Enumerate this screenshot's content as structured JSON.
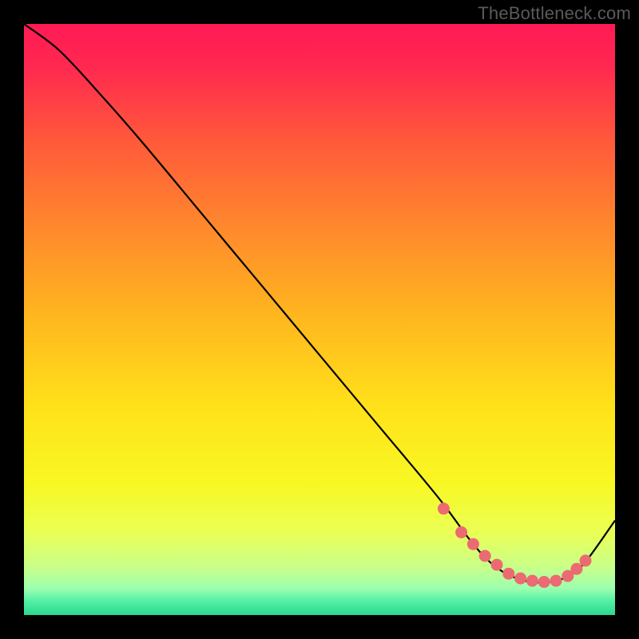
{
  "attribution": "TheBottleneck.com",
  "chart_data": {
    "type": "line",
    "title": "",
    "xlabel": "",
    "ylabel": "",
    "xlim": [
      0,
      100
    ],
    "ylim": [
      0,
      100
    ],
    "series": [
      {
        "name": "curve",
        "x": [
          0,
          6,
          13,
          20,
          30,
          40,
          50,
          60,
          70,
          76,
          80,
          84,
          88,
          92,
          95,
          100
        ],
        "y": [
          100,
          95.5,
          88,
          80,
          68,
          56,
          44,
          32,
          20,
          12,
          8,
          6,
          5.5,
          6.5,
          9,
          16
        ]
      }
    ],
    "markers": {
      "name": "highlight-dots",
      "x": [
        71,
        74,
        76,
        78,
        80,
        82,
        84,
        86,
        88,
        90,
        92,
        93.5,
        95
      ],
      "y": [
        18,
        14,
        12,
        10,
        8.5,
        7,
        6.2,
        5.8,
        5.6,
        5.8,
        6.6,
        7.8,
        9.2
      ]
    },
    "background_gradient": {
      "stops": [
        {
          "offset": 0.0,
          "color": "#ff1a55"
        },
        {
          "offset": 0.07,
          "color": "#ff2850"
        },
        {
          "offset": 0.2,
          "color": "#ff5a3a"
        },
        {
          "offset": 0.35,
          "color": "#ff8a2c"
        },
        {
          "offset": 0.5,
          "color": "#ffb81e"
        },
        {
          "offset": 0.65,
          "color": "#ffe21a"
        },
        {
          "offset": 0.78,
          "color": "#f8f824"
        },
        {
          "offset": 0.86,
          "color": "#eaff55"
        },
        {
          "offset": 0.92,
          "color": "#c8ff8a"
        },
        {
          "offset": 0.955,
          "color": "#9dffb0"
        },
        {
          "offset": 0.975,
          "color": "#58f0a8"
        },
        {
          "offset": 1.0,
          "color": "#28d98c"
        }
      ]
    },
    "marker_color": "#ec6a72",
    "line_color": "#000000"
  }
}
